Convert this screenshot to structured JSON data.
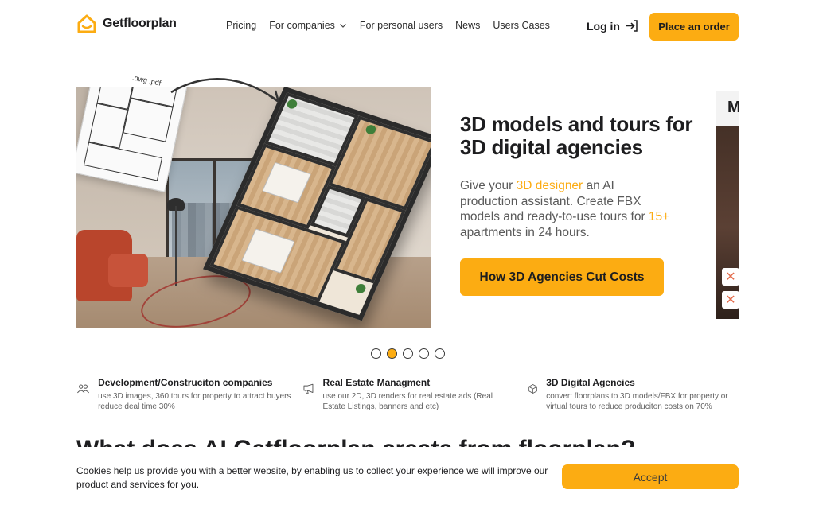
{
  "header": {
    "logo_text": "Getfloorplan",
    "nav": [
      {
        "label": "Pricing"
      },
      {
        "label": "For companies"
      },
      {
        "label": "For personal users"
      },
      {
        "label": "News"
      },
      {
        "label": "Users Cases"
      }
    ],
    "login_label": "Log in",
    "order_label": "Place an order"
  },
  "hero": {
    "plan_formats": ".dwg .pdf",
    "title": "3D models and tours for 3D digital agencies",
    "desc_part1": "Give your ",
    "desc_hl1": "3D designer",
    "desc_part2": " an AI production assistant. Create FBX models and ready-to-use tours for ",
    "desc_hl2": "15+",
    "desc_part3": " apartments in 24 hours.",
    "cta_label": "How 3D Agencies Cut Costs",
    "next_slide_caption": "M",
    "slides_count": 5,
    "active_slide": 2
  },
  "features": [
    {
      "title": "Development/Construciton companies",
      "text": "use 3D images, 360 tours for property to attract buyers reduce deal time 30%",
      "icon": "users-icon"
    },
    {
      "title": "Real Estate Managment",
      "text": "use our 2D, 3D renders for real estate ads (Real Estate Listings, banners and etc)",
      "icon": "megaphone-icon"
    },
    {
      "title": "3D Digital Agencies",
      "text": "convert floorplans to 3D models/FBX for property or virtual tours to reduce produciton costs on 70%",
      "icon": "cube-icon"
    }
  ],
  "section_title": "What does AI Getfloorplan create from floorplan?",
  "cookie": {
    "text": "Cookies help us provide you with a better website, by enabling us to collect your experience we will improve our product and services for you.",
    "accept_label": "Accept"
  },
  "colors": {
    "accent": "#fcac12",
    "text": "#1d1d1f",
    "muted": "#5a5a5a"
  }
}
